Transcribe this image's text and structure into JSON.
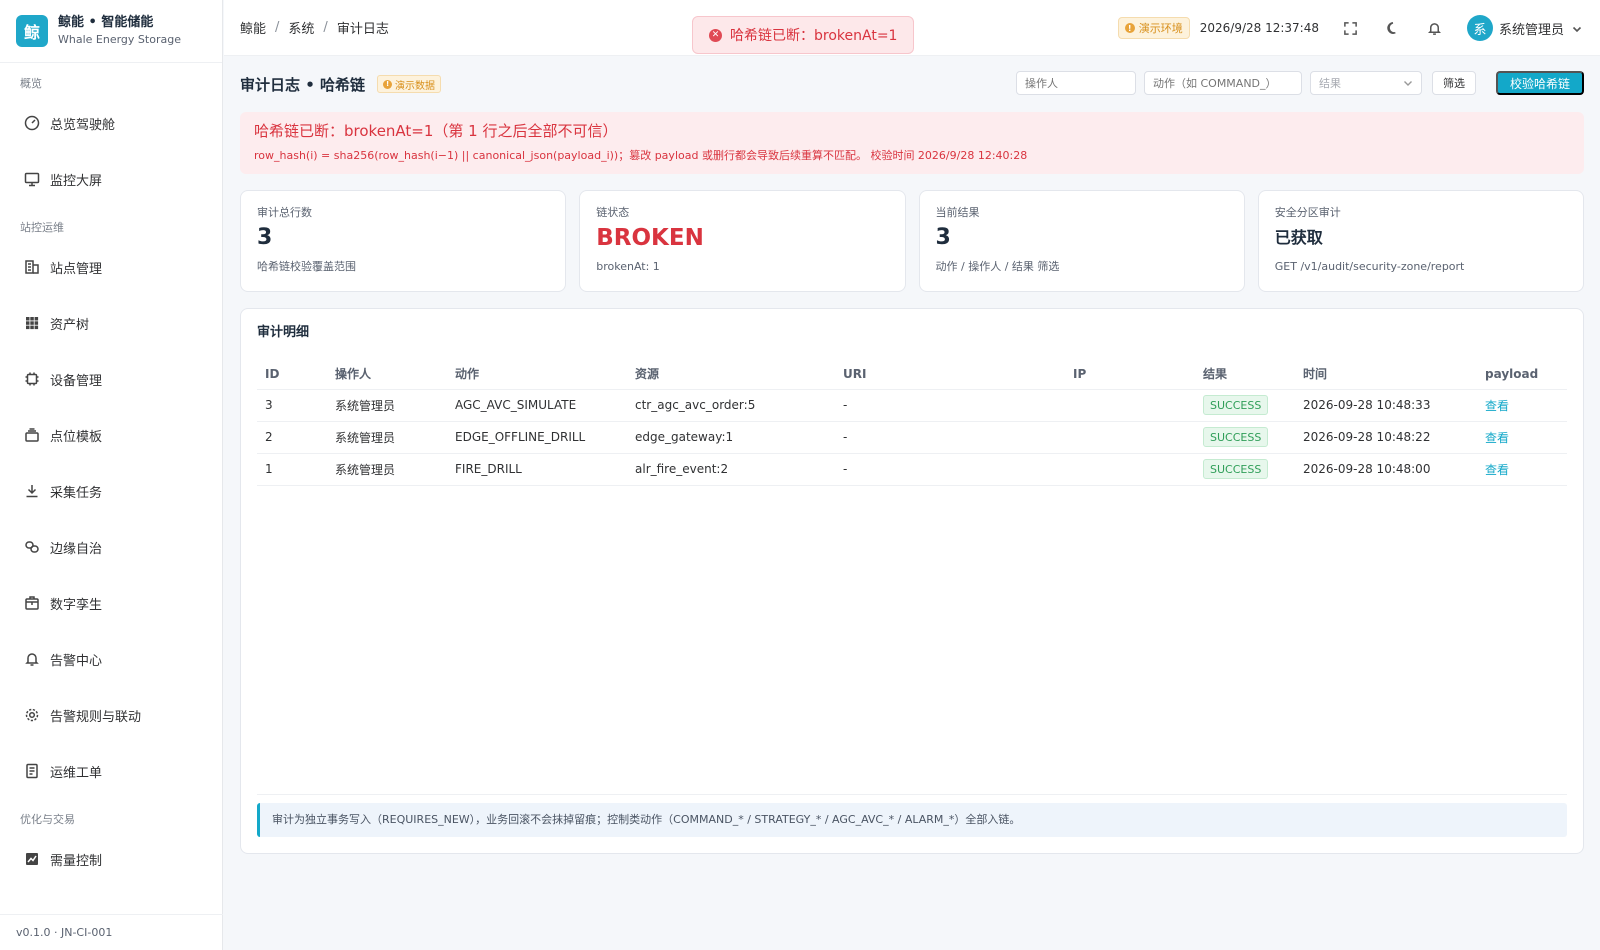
{
  "brand": {
    "logo_char": "鲸",
    "title": "鲸能 • 智能储能",
    "subtitle": "Whale Energy Storage"
  },
  "sidebar": {
    "groups": [
      {
        "label": "概览",
        "items": [
          {
            "label": "总览驾驶舱",
            "icon": "gauge-icon"
          },
          {
            "label": "监控大屏",
            "icon": "monitor-icon"
          }
        ]
      },
      {
        "label": "站控运维",
        "items": [
          {
            "label": "站点管理",
            "icon": "building-icon"
          },
          {
            "label": "资产树",
            "icon": "grid-icon"
          },
          {
            "label": "设备管理",
            "icon": "chip-icon"
          },
          {
            "label": "点位模板",
            "icon": "layers-icon"
          },
          {
            "label": "采集任务",
            "icon": "download-icon"
          },
          {
            "label": "边缘自治",
            "icon": "link-icon"
          },
          {
            "label": "数字孪生",
            "icon": "box-icon"
          },
          {
            "label": "告警中心",
            "icon": "bell-icon"
          },
          {
            "label": "告警规则与联动",
            "icon": "gear-icon"
          },
          {
            "label": "运维工单",
            "icon": "document-icon"
          }
        ]
      },
      {
        "label": "优化与交易",
        "items": [
          {
            "label": "需量控制",
            "icon": "chart-icon"
          }
        ]
      }
    ],
    "footer": "v0.1.0 · JN-CI-001"
  },
  "header": {
    "breadcrumb": [
      "鲸能",
      "系统",
      "审计日志"
    ],
    "toast": "哈希链已断：brokenAt=1",
    "env_badge": "演示环境",
    "clock": "2026/9/28 12:37:48",
    "avatar_char": "系",
    "username": "系统管理员"
  },
  "page": {
    "title": "审计日志 • 哈希链",
    "demo_tag": "演示数据",
    "filters": {
      "operator_placeholder": "操作人",
      "action_placeholder": "动作（如 COMMAND_）",
      "result_placeholder": "结果",
      "filter_label": "筛选",
      "verify_label": "校验哈希链"
    },
    "alert": {
      "title": "哈希链已断：brokenAt=1（第 1 行之后全部不可信）",
      "desc": "row_hash(i) = sha256(row_hash(i−1) || canonical_json(payload_i))；篡改 payload 或删行都会导致后续重算不匹配。 校验时间 2026/9/28 12:40:28"
    },
    "stats": [
      {
        "label": "审计总行数",
        "value": "3",
        "sub": "哈希链校验覆盖范围"
      },
      {
        "label": "链状态",
        "value": "BROKEN",
        "sub": "brokenAt: 1"
      },
      {
        "label": "当前结果",
        "value": "3",
        "sub": "动作 / 操作人 / 结果 筛选"
      },
      {
        "label": "安全分区审计",
        "value": "已获取",
        "sub": "GET /v1/audit/security-zone/report"
      }
    ],
    "panel_title": "审计明细",
    "table": {
      "columns": [
        "ID",
        "操作人",
        "动作",
        "资源",
        "URI",
        "IP",
        "结果",
        "时间",
        "payload"
      ],
      "rows": [
        {
          "id": "3",
          "operator": "系统管理员",
          "action": "AGC_AVC_SIMULATE",
          "resource": "ctr_agc_avc_order:5",
          "uri": "-",
          "ip": "",
          "result": "SUCCESS",
          "time": "2026-09-28 10:48:33",
          "payload": "查看"
        },
        {
          "id": "2",
          "operator": "系统管理员",
          "action": "EDGE_OFFLINE_DRILL",
          "resource": "edge_gateway:1",
          "uri": "-",
          "ip": "",
          "result": "SUCCESS",
          "time": "2026-09-28 10:48:22",
          "payload": "查看"
        },
        {
          "id": "1",
          "operator": "系统管理员",
          "action": "FIRE_DRILL",
          "resource": "alr_fire_event:2",
          "uri": "-",
          "ip": "",
          "result": "SUCCESS",
          "time": "2026-09-28 10:48:00",
          "payload": "查看"
        }
      ]
    },
    "info": "审计为独立事务写入（REQUIRES_NEW），业务回滚不会抹掉留痕；控制类动作（COMMAND_* / STRATEGY_* / AGC_AVC_* / ALARM_*）全部入链。"
  },
  "colors": {
    "accent": "#13a8c9",
    "danger": "#d9343f",
    "warning": "#d8901d",
    "success": "#2f9e58"
  }
}
